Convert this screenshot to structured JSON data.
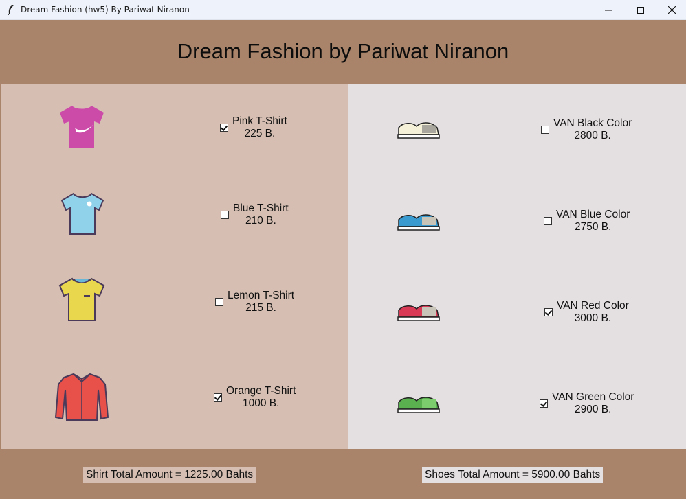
{
  "window": {
    "title": "Dream Fashion (hw5) By Pariwat Niranon"
  },
  "header": {
    "title": "Dream Fashion by Pariwat Niranon"
  },
  "shirts": [
    {
      "name": "Pink T-Shirt",
      "price": "225 B.",
      "checked": true,
      "icon": "pink-tshirt-icon",
      "color": "#cc4ba9"
    },
    {
      "name": "Blue T-Shirt",
      "price": "210 B.",
      "checked": false,
      "icon": "blue-tshirt-icon",
      "color": "#8fd2ea"
    },
    {
      "name": "Lemon T-Shirt",
      "price": "215 B.",
      "checked": false,
      "icon": "lemon-tshirt-icon",
      "color": "#e9d84e"
    },
    {
      "name": "Orange T-Shirt",
      "price": "1000 B.",
      "checked": true,
      "icon": "orange-shirt-icon",
      "color": "#e8514a"
    }
  ],
  "shoes": [
    {
      "name": "VAN Black Color",
      "price": "2800 B.",
      "checked": false,
      "icon": "van-black-shoe-icon",
      "color": "#f4f1d8"
    },
    {
      "name": "VAN Blue Color",
      "price": "2750 B.",
      "checked": false,
      "icon": "van-blue-shoe-icon",
      "color": "#3a9bd0"
    },
    {
      "name": "VAN Red Color",
      "price": "3000 B.",
      "checked": true,
      "icon": "van-red-shoe-icon",
      "color": "#d93a55"
    },
    {
      "name": "VAN Green Color",
      "price": "2900 B.",
      "checked": true,
      "icon": "van-green-shoe-icon",
      "color": "#5ab04f"
    }
  ],
  "footer": {
    "shirt_total": "Shirt Total Amount = 1225.00 Bahts",
    "shoes_total": "Shoes Total Amount = 5900.00 Bahts"
  }
}
